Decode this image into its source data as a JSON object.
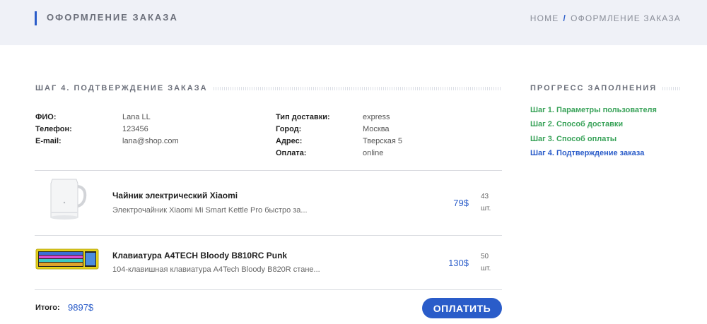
{
  "header": {
    "title": "ОФОРМЛЕНИЕ ЗАКАЗА",
    "breadcrumb": {
      "home": "HOME",
      "separator": "/",
      "current": "ОФОРМЛЕНИЕ ЗАКАЗА"
    }
  },
  "order": {
    "heading": "ШАГ 4. ПОДТВЕРЖДЕНИЕ ЗАКАЗА",
    "user": {
      "name_label": "ФИО:",
      "name": "Lana LL",
      "phone_label": "Телефон:",
      "phone": "123456",
      "email_label": "E-mail:",
      "email": "lana@shop.com"
    },
    "delivery": {
      "type_label": "Тип доставки:",
      "type": "express",
      "city_label": "Город:",
      "city": "Москва",
      "address_label": "Адрес:",
      "address": "Тверская 5",
      "payment_label": "Оплата:",
      "payment": "online"
    },
    "items": [
      {
        "name": "Чайник электрический Xiaomi",
        "description": "Электрочайник Xiaomi Mi Smart Kettle Pro быстро за...",
        "price": "79$",
        "qty": "43",
        "unit": "шт.",
        "icon": "kettle-icon"
      },
      {
        "name": "Клавиатура A4TECH Bloody B810RC Punk",
        "description": "104-клавишная клавиатура A4Tech Bloody B820R стане...",
        "price": "130$",
        "qty": "50",
        "unit": "шт.",
        "icon": "keyboard-icon"
      }
    ],
    "total_label": "Итого:",
    "total": "9897$",
    "pay_label": "ОПЛАТИТЬ"
  },
  "progress": {
    "heading": "ПРОГРЕСС ЗАПОЛНЕНИЯ",
    "steps": [
      {
        "label": "Шаг 1. Параметры пользователя",
        "state": "done"
      },
      {
        "label": "Шаг 2. Способ доставки",
        "state": "done"
      },
      {
        "label": "Шаг 3. Способ оплаты",
        "state": "done"
      },
      {
        "label": "Шаг 4. Подтверждение заказа",
        "state": "active"
      }
    ]
  },
  "colors": {
    "accent": "#2a5cc9",
    "done": "#3aa35a",
    "header_bg": "#eff1f7"
  }
}
